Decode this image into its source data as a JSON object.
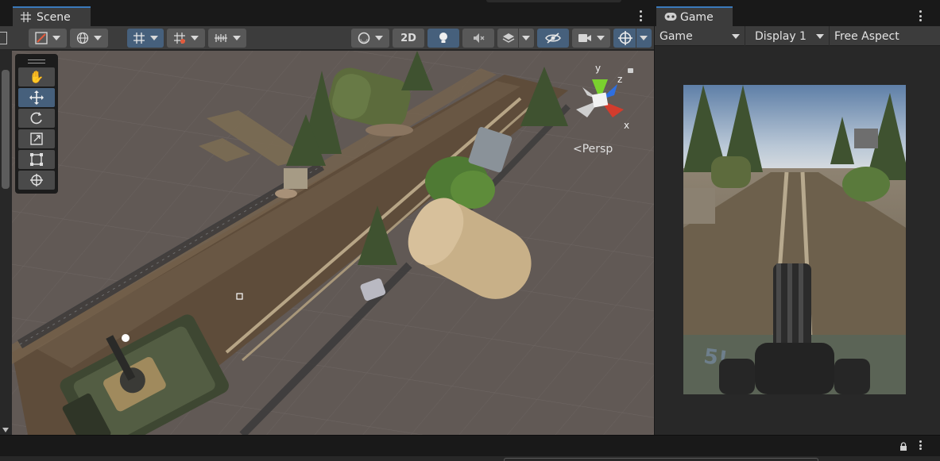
{
  "scene": {
    "tab_label": "Scene",
    "tab_icon": "grid-icon",
    "toolbar": {
      "mode_2d_label": "2D"
    },
    "tools": [
      "hand-tool",
      "move-tool",
      "rotate-tool",
      "scale-tool",
      "rect-tool",
      "transform-tool"
    ],
    "active_tool": "move-tool",
    "gizmo": {
      "projection_label": "Persp",
      "axis_y": "y",
      "axis_z": "z",
      "axis_x": "x"
    }
  },
  "game": {
    "tab_label": "Game",
    "tab_icon": "gamepad-icon",
    "view_select": "Game",
    "display_select": "Display 1",
    "aspect_select": "Free Aspect"
  },
  "colors": {
    "active_tab_accent": "#3a79bb",
    "active_button": "#46607c",
    "panel": "#3c3c3c",
    "background": "#191919",
    "axis_x": "#d23c2d",
    "axis_y": "#7ad12e",
    "axis_z": "#2e6fe0"
  }
}
